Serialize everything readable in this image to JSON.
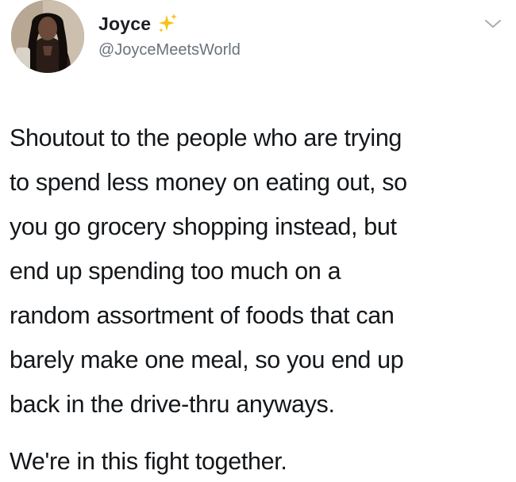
{
  "tweet": {
    "author": {
      "display_name": "Joyce",
      "handle": "@JoyceMeetsWorld",
      "avatar_icon": "profile-photo",
      "badge_icon": "sparkles-icon",
      "badge_color": "#f5c518"
    },
    "menu_icon": "chevron-down-icon",
    "body_lines": [
      "Shoutout to the people who are trying",
      "to spend less money on eating out, so",
      "you go grocery shopping instead, but",
      "end up spending too much on a",
      "random assortment of foods that can",
      "barely make one meal, so you end up",
      "back in the drive-thru anyways."
    ],
    "closing_line": "We're in this fight together."
  }
}
